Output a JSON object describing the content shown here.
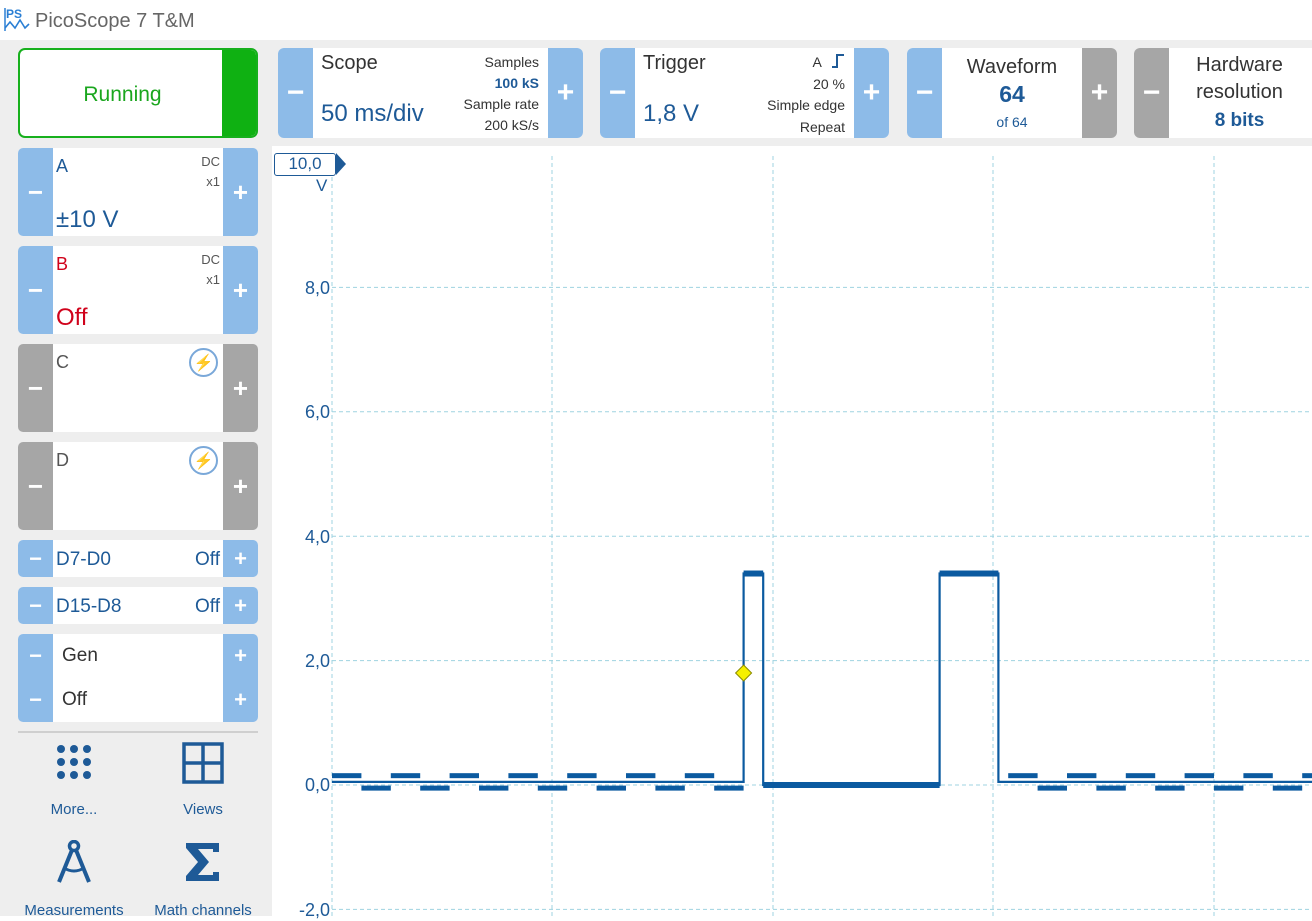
{
  "app": {
    "title": "PicoScope 7 T&M"
  },
  "run": {
    "label": "Running"
  },
  "channels": [
    {
      "name": "A",
      "coupling": "DC",
      "probe": "x1",
      "range": "±10 V",
      "color": "#1e5a97",
      "enabled": true
    },
    {
      "name": "B",
      "coupling": "DC",
      "probe": "x1",
      "range": "Off",
      "color": "#d0021b",
      "enabled": true
    },
    {
      "name": "C",
      "coupling": "",
      "probe": "",
      "range": "",
      "color": "#555555",
      "enabled": false
    },
    {
      "name": "D",
      "coupling": "",
      "probe": "",
      "range": "",
      "color": "#555555",
      "enabled": false
    }
  ],
  "digital": [
    {
      "name": "D7-D0",
      "value": "Off"
    },
    {
      "name": "D15-D8",
      "value": "Off"
    }
  ],
  "generator": {
    "label": "Gen",
    "value": "Off"
  },
  "tools": [
    {
      "label": "More...",
      "icon": "dots-grid-icon"
    },
    {
      "label": "Views",
      "icon": "views-grid-icon"
    },
    {
      "label": "Measurements",
      "icon": "compass-icon"
    },
    {
      "label": "Math channels",
      "icon": "sigma-icon"
    }
  ],
  "toolbar": {
    "scope": {
      "title": "Scope",
      "value": "50 ms/div",
      "samples_label": "Samples",
      "samples_value": "100 kS",
      "rate_label": "Sample rate",
      "rate_value": "200 kS/s"
    },
    "trigger": {
      "title": "Trigger",
      "value": "1,8 V",
      "channel": "A",
      "edge_icon": "rising-edge-icon",
      "pretrigger": "20 %",
      "type": "Simple edge",
      "mode": "Repeat"
    },
    "waveform": {
      "title": "Waveform",
      "value": "64",
      "total": "of 64"
    },
    "hardware": {
      "title_line1": "Hardware",
      "title_line2": "resolution",
      "value": "8 bits"
    }
  },
  "plot": {
    "range_flag": "10,0",
    "unit": "V",
    "y_labels": [
      "8,0",
      "6,0",
      "4,0",
      "2,0",
      "0,0",
      "-2,0"
    ],
    "trace_color": "#0b5aa0",
    "trigger_marker_color": "#f5f000"
  },
  "chart_data": {
    "type": "line",
    "ylabel": "V",
    "ylim": [
      -2,
      10
    ],
    "series": [
      {
        "x": [
          0,
          0.42,
          0.42,
          0.44,
          0.44,
          0.62,
          0.62,
          0.68,
          0.68,
          1.0
        ],
        "y": [
          0.05,
          0.05,
          3.4,
          3.4,
          0.0,
          0.0,
          3.4,
          3.4,
          0.05,
          0.05
        ]
      }
    ],
    "trigger_level": 1.8,
    "grid": true
  }
}
